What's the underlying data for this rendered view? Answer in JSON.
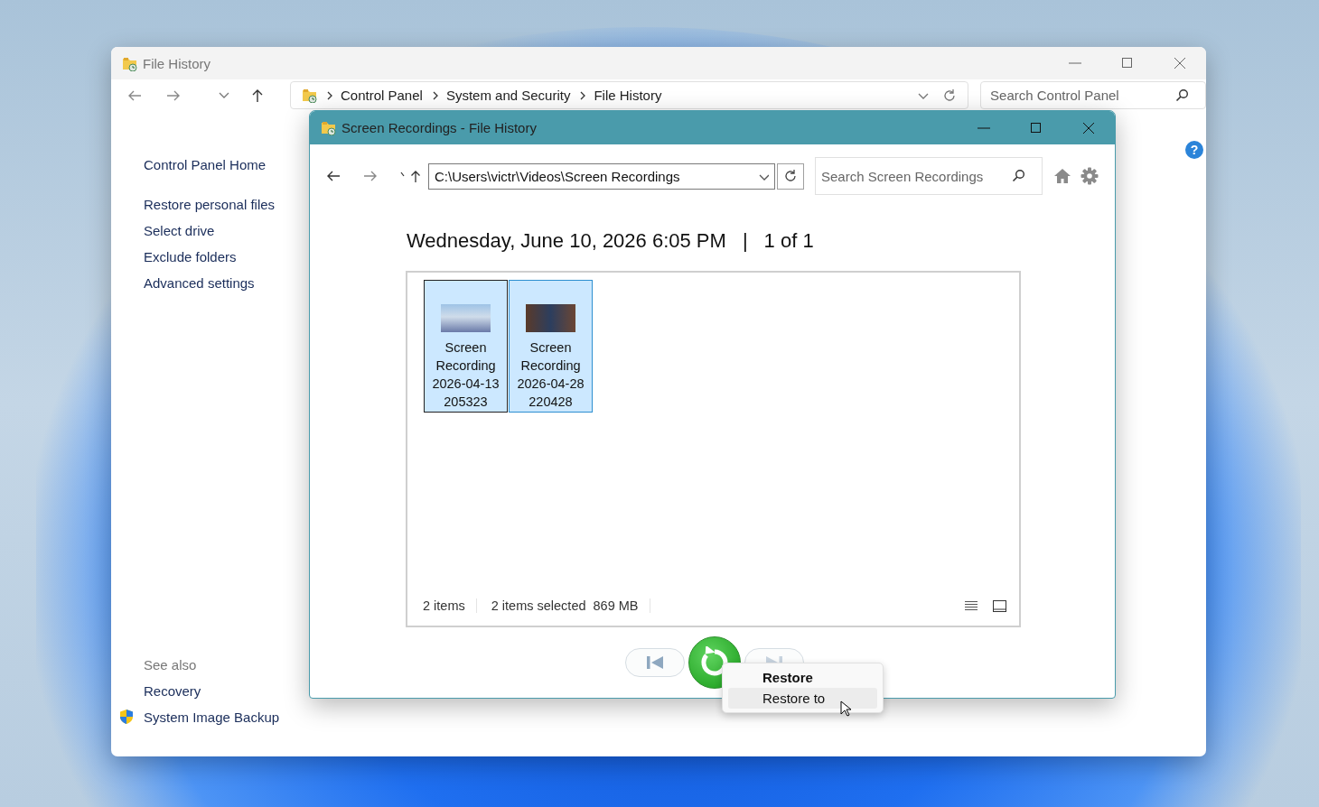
{
  "back_window": {
    "title": "File History",
    "breadcrumb": [
      "Control Panel",
      "System and Security",
      "File History"
    ],
    "search": {
      "placeholder": "Search Control Panel"
    },
    "help": "?",
    "sidebar": {
      "links": [
        {
          "label": "Control Panel Home",
          "kind": "home"
        },
        {
          "label": "Restore personal files",
          "kind": "task"
        },
        {
          "label": "Select drive",
          "kind": "task"
        },
        {
          "label": "Exclude folders",
          "kind": "task"
        },
        {
          "label": "Advanced settings",
          "kind": "task"
        }
      ],
      "see_also_heading": "See also",
      "see_also": [
        {
          "label": "Recovery",
          "kind": "plain"
        },
        {
          "label": "System Image Backup",
          "kind": "shield"
        }
      ]
    }
  },
  "front_window": {
    "title": "Screen Recordings - File History",
    "address": "C:\\Users\\victr\\Videos\\Screen Recordings",
    "search": {
      "placeholder": "Search Screen Recordings"
    },
    "backup_date": "Wednesday, June 10, 2026 6:05 PM",
    "separator": "|",
    "position": "1 of 1",
    "files": [
      {
        "name": "Screen Recording 2026-04-13 205323",
        "selected": true,
        "focused": true
      },
      {
        "name": "Screen Recording 2026-04-28 220428",
        "selected": true,
        "focused": false
      }
    ],
    "status": {
      "count": "2 items",
      "selection": "2 items selected",
      "size": "869 MB"
    }
  },
  "context_menu": {
    "items": [
      {
        "label": "Restore",
        "default": true,
        "highlighted": false
      },
      {
        "label": "Restore to",
        "default": false,
        "highlighted": true
      }
    ]
  }
}
